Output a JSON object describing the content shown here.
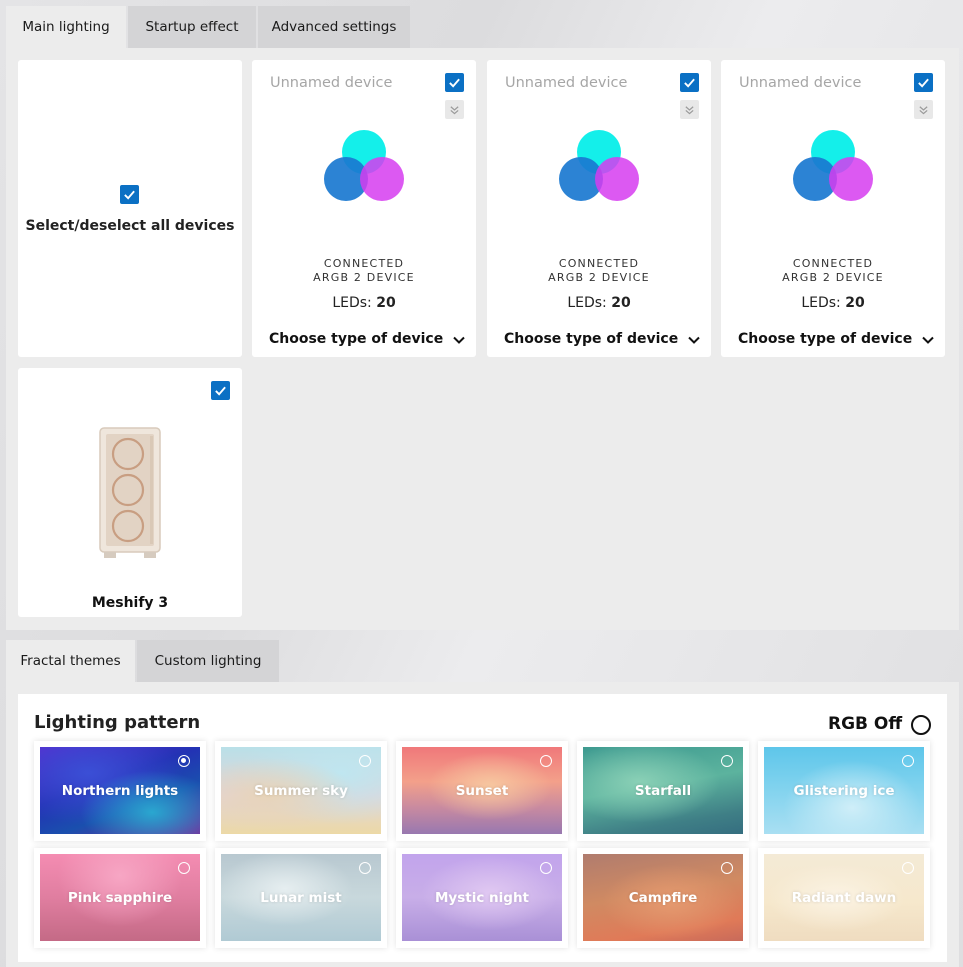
{
  "top_tabs": [
    "Main lighting",
    "Startup effect",
    "Advanced settings"
  ],
  "select_all_label": "Select/deselect all devices",
  "devices": [
    {
      "name": "Unnamed device",
      "status_line1": "CONNECTED",
      "status_line2": "ARGB 2 DEVICE",
      "leds_label": "LEDs:",
      "leds_count": "20",
      "type_label": "Choose type of device"
    },
    {
      "name": "Unnamed device",
      "status_line1": "CONNECTED",
      "status_line2": "ARGB 2 DEVICE",
      "leds_label": "LEDs:",
      "leds_count": "20",
      "type_label": "Choose type of device"
    },
    {
      "name": "Unnamed device",
      "status_line1": "CONNECTED",
      "status_line2": "ARGB 2 DEVICE",
      "leds_label": "LEDs:",
      "leds_count": "20",
      "type_label": "Choose type of device"
    }
  ],
  "case_device": {
    "name": "Meshify 3"
  },
  "bottom_tabs": [
    "Fractal themes",
    "Custom lighting"
  ],
  "lighting_pattern": {
    "title": "Lighting pattern",
    "rgb_off_label": "RGB Off",
    "themes": [
      {
        "label": "Northern lights",
        "selected": true
      },
      {
        "label": "Summer sky",
        "selected": false
      },
      {
        "label": "Sunset",
        "selected": false
      },
      {
        "label": "Starfall",
        "selected": false
      },
      {
        "label": "Glistering ice",
        "selected": false
      },
      {
        "label": "Pink sapphire",
        "selected": false
      },
      {
        "label": "Lunar mist",
        "selected": false
      },
      {
        "label": "Mystic night",
        "selected": false
      },
      {
        "label": "Campfire",
        "selected": false
      },
      {
        "label": "Radiant dawn",
        "selected": false
      }
    ]
  },
  "colors": {
    "accent": "#0b70c4",
    "cyan": "#00eee8",
    "blue": "#1a78d0",
    "magenta": "#d63cf0"
  }
}
